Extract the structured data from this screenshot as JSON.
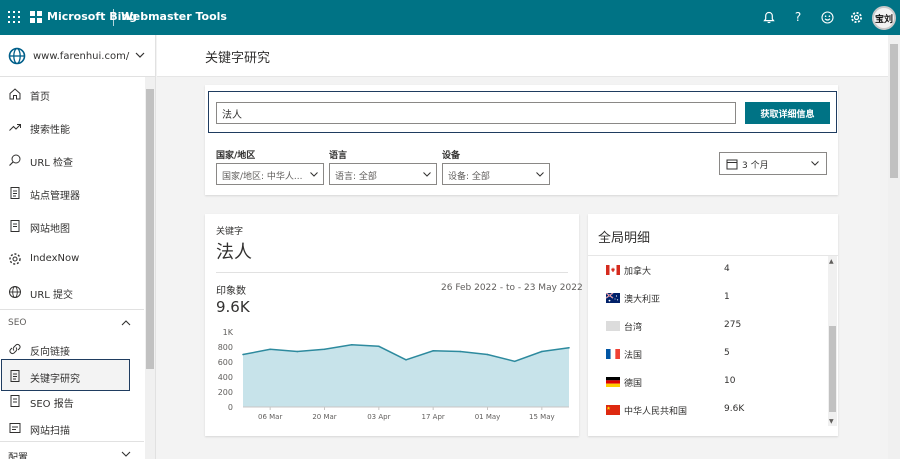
{
  "topbar": {
    "brand": "Microsoft Bing",
    "product": "Webmaster Tools",
    "avatar": "宝刘",
    "icons": [
      "bell-icon",
      "help-icon",
      "smile-icon",
      "gear-icon"
    ]
  },
  "sidebar": {
    "site": "www.farenhui.com/",
    "items": [
      {
        "label": "首页",
        "icon": "home-icon"
      },
      {
        "label": "搜索性能",
        "icon": "trend-icon"
      },
      {
        "label": "URL 检查",
        "icon": "search-icon"
      },
      {
        "label": "站点管理器",
        "icon": "document-icon"
      },
      {
        "label": "网站地图",
        "icon": "sitemap-icon"
      },
      {
        "label": "IndexNow",
        "icon": "gear-icon"
      },
      {
        "label": "URL 提交",
        "icon": "globe-icon"
      }
    ],
    "seo_section": "SEO",
    "seo_items": [
      {
        "label": "反向链接",
        "icon": "link-icon"
      },
      {
        "label": "关键字研究",
        "icon": "document-icon"
      },
      {
        "label": "SEO 报告",
        "icon": "report-icon"
      },
      {
        "label": "网站扫描",
        "icon": "scan-icon"
      }
    ],
    "config_section": "配置"
  },
  "page": {
    "title": "关键字研究"
  },
  "search": {
    "value": "法人",
    "button": "获取详细信息",
    "filters": [
      {
        "label": "国家/地区",
        "value": "国家/地区: 中华人..."
      },
      {
        "label": "语言",
        "value": "语言: 全部"
      },
      {
        "label": "设备",
        "value": "设备: 全部"
      }
    ],
    "date_range": "3 个月"
  },
  "keyword_card": {
    "label": "关键字",
    "keyword": "法人",
    "impressions_label": "印象数",
    "impressions_value": "9.6K",
    "range": "26 Feb 2022 - to - 23 May 2022"
  },
  "chart_data": {
    "type": "area",
    "yticks": [
      "1K",
      "800",
      "600",
      "400",
      "200",
      "0"
    ],
    "ylim": [
      0,
      1000
    ],
    "xticks": [
      "06 Mar",
      "20 Mar",
      "03 Apr",
      "17 Apr",
      "01 May",
      "15 May"
    ],
    "xtick_positions": [
      1,
      3,
      5,
      7,
      9,
      11
    ],
    "values": [
      700,
      770,
      740,
      770,
      830,
      810,
      630,
      750,
      740,
      700,
      610,
      740,
      790
    ],
    "color": "#c7e3ea",
    "line_color": "#2d8a9e"
  },
  "global": {
    "title": "全局明细",
    "rows": [
      {
        "country": "加拿大",
        "value": "4",
        "flag": "canada-flag-icon"
      },
      {
        "country": "澳大利亚",
        "value": "1",
        "flag": "australia-flag-icon"
      },
      {
        "country": "台湾",
        "value": "275",
        "flag": "blank-flag-icon"
      },
      {
        "country": "法国",
        "value": "5",
        "flag": "france-flag-icon"
      },
      {
        "country": "德国",
        "value": "10",
        "flag": "germany-flag-icon"
      },
      {
        "country": "中华人民共和国",
        "value": "9.6K",
        "flag": "china-flag-icon"
      }
    ]
  },
  "colors": {
    "accent": "#007385",
    "focus": "#1f3c60"
  }
}
